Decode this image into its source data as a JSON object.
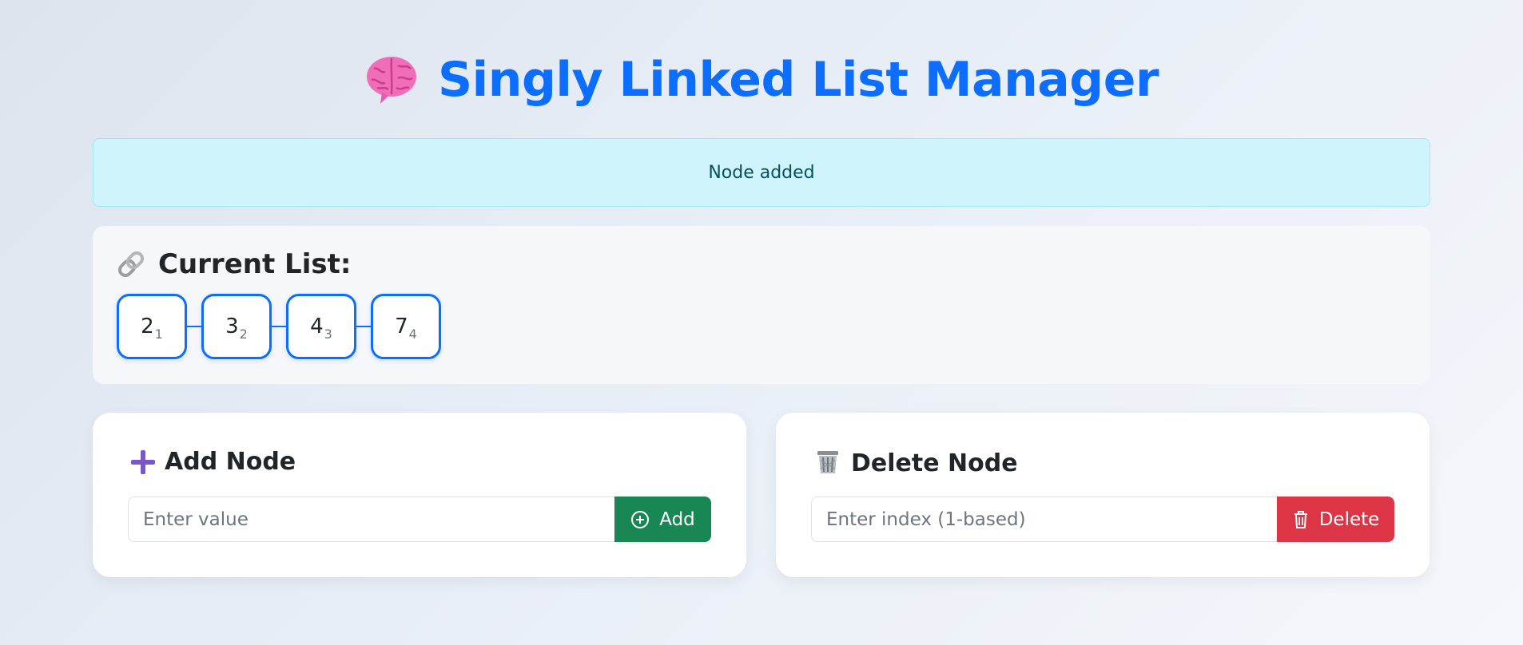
{
  "header": {
    "title": "Singly Linked List Manager",
    "icon": "brain-icon"
  },
  "alert": {
    "message": "Node added",
    "color": "#cff4fc"
  },
  "list": {
    "heading": "Current List:",
    "icon": "link-icon",
    "nodes": [
      {
        "value": "2",
        "index": "1"
      },
      {
        "value": "3",
        "index": "2"
      },
      {
        "value": "4",
        "index": "3"
      },
      {
        "value": "7",
        "index": "4"
      }
    ]
  },
  "add_card": {
    "heading": "Add Node",
    "icon": "plus-icon",
    "input_placeholder": "Enter value",
    "input_value": "",
    "button_label": "Add",
    "button_color": "#198754"
  },
  "delete_card": {
    "heading": "Delete Node",
    "icon": "trash-icon",
    "input_placeholder": "Enter index (1-based)",
    "input_value": "",
    "button_label": "Delete",
    "button_color": "#dc3545"
  },
  "colors": {
    "accent": "#0d6efd"
  }
}
